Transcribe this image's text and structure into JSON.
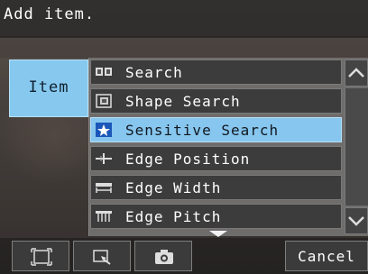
{
  "dialog": {
    "title": "Add item."
  },
  "category_tab": {
    "label": "Item"
  },
  "items": [
    {
      "label": "Search",
      "icon": "search-pattern-icon",
      "selected": false
    },
    {
      "label": "Shape Search",
      "icon": "shape-search-icon",
      "selected": false
    },
    {
      "label": "Sensitive Search",
      "icon": "sensitive-search-icon",
      "selected": true
    },
    {
      "label": "Edge Position",
      "icon": "edge-position-icon",
      "selected": false
    },
    {
      "label": "Edge Width",
      "icon": "edge-width-icon",
      "selected": false
    },
    {
      "label": "Edge Pitch",
      "icon": "edge-pitch-icon",
      "selected": false
    }
  ],
  "toolbar": {
    "tools": [
      "fit-frame-icon",
      "zoom-region-icon",
      "camera-icon"
    ],
    "cancel_label": "Cancel"
  },
  "colors": {
    "selected": "#87c6ee",
    "item_bg": "#3c3c3c",
    "tab_bg": "#86c8ee"
  }
}
